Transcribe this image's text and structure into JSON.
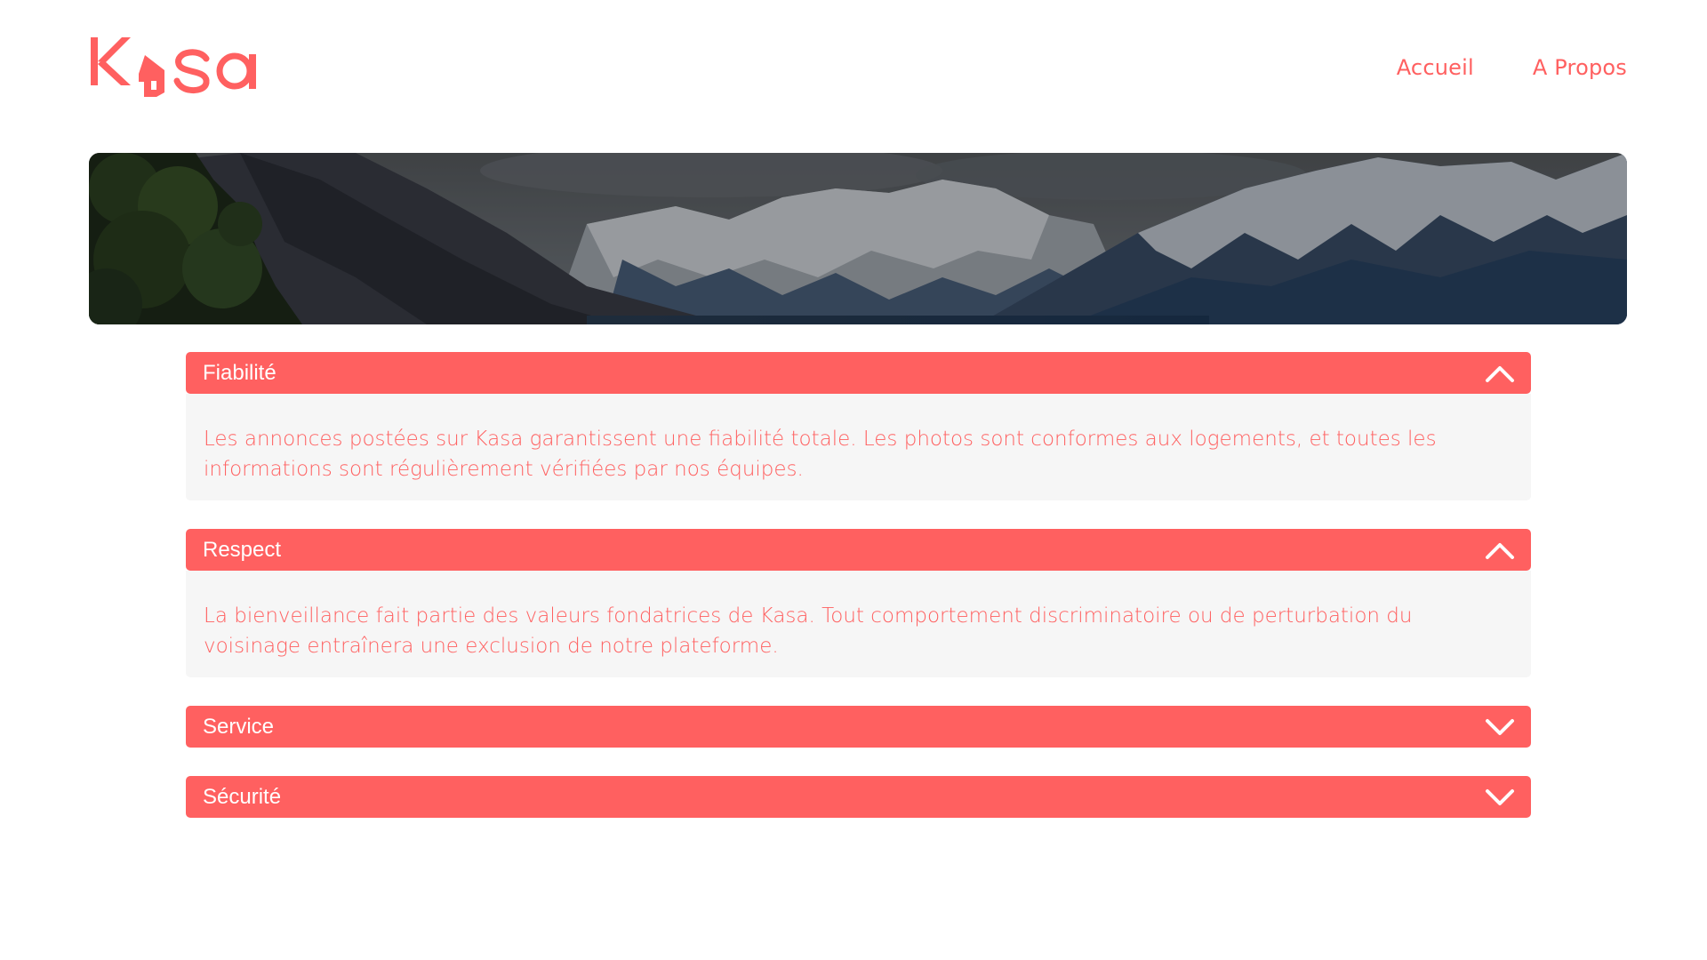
{
  "header": {
    "logo_label": "Kasa",
    "nav": [
      {
        "label": "Accueil"
      },
      {
        "label": "A Propos"
      }
    ]
  },
  "banner": {
    "description": ""
  },
  "sections": [
    {
      "title": "Fiabilité",
      "expanded": true,
      "chevron": "chevron-up-icon",
      "text": "Les annonces postées sur Kasa garantissent une fiabilité totale. Les photos sont conformes aux logements, et toutes les informations sont régulièrement vérifiées par nos équipes."
    },
    {
      "title": "Respect",
      "expanded": true,
      "chevron": "chevron-up-icon",
      "text": "La bienveillance fait partie des valeurs fondatrices de Kasa. Tout comportement discriminatoire ou de perturbation du voisinage entraînera une exclusion de notre plateforme."
    },
    {
      "title": "Service",
      "expanded": false,
      "chevron": "chevron-down-icon",
      "text": ""
    },
    {
      "title": "Sécurité",
      "expanded": false,
      "chevron": "chevron-down-icon",
      "text": ""
    }
  ],
  "colors": {
    "brand": "#FF6060",
    "panel": "#F6F6F6",
    "white": "#FFFFFF"
  }
}
